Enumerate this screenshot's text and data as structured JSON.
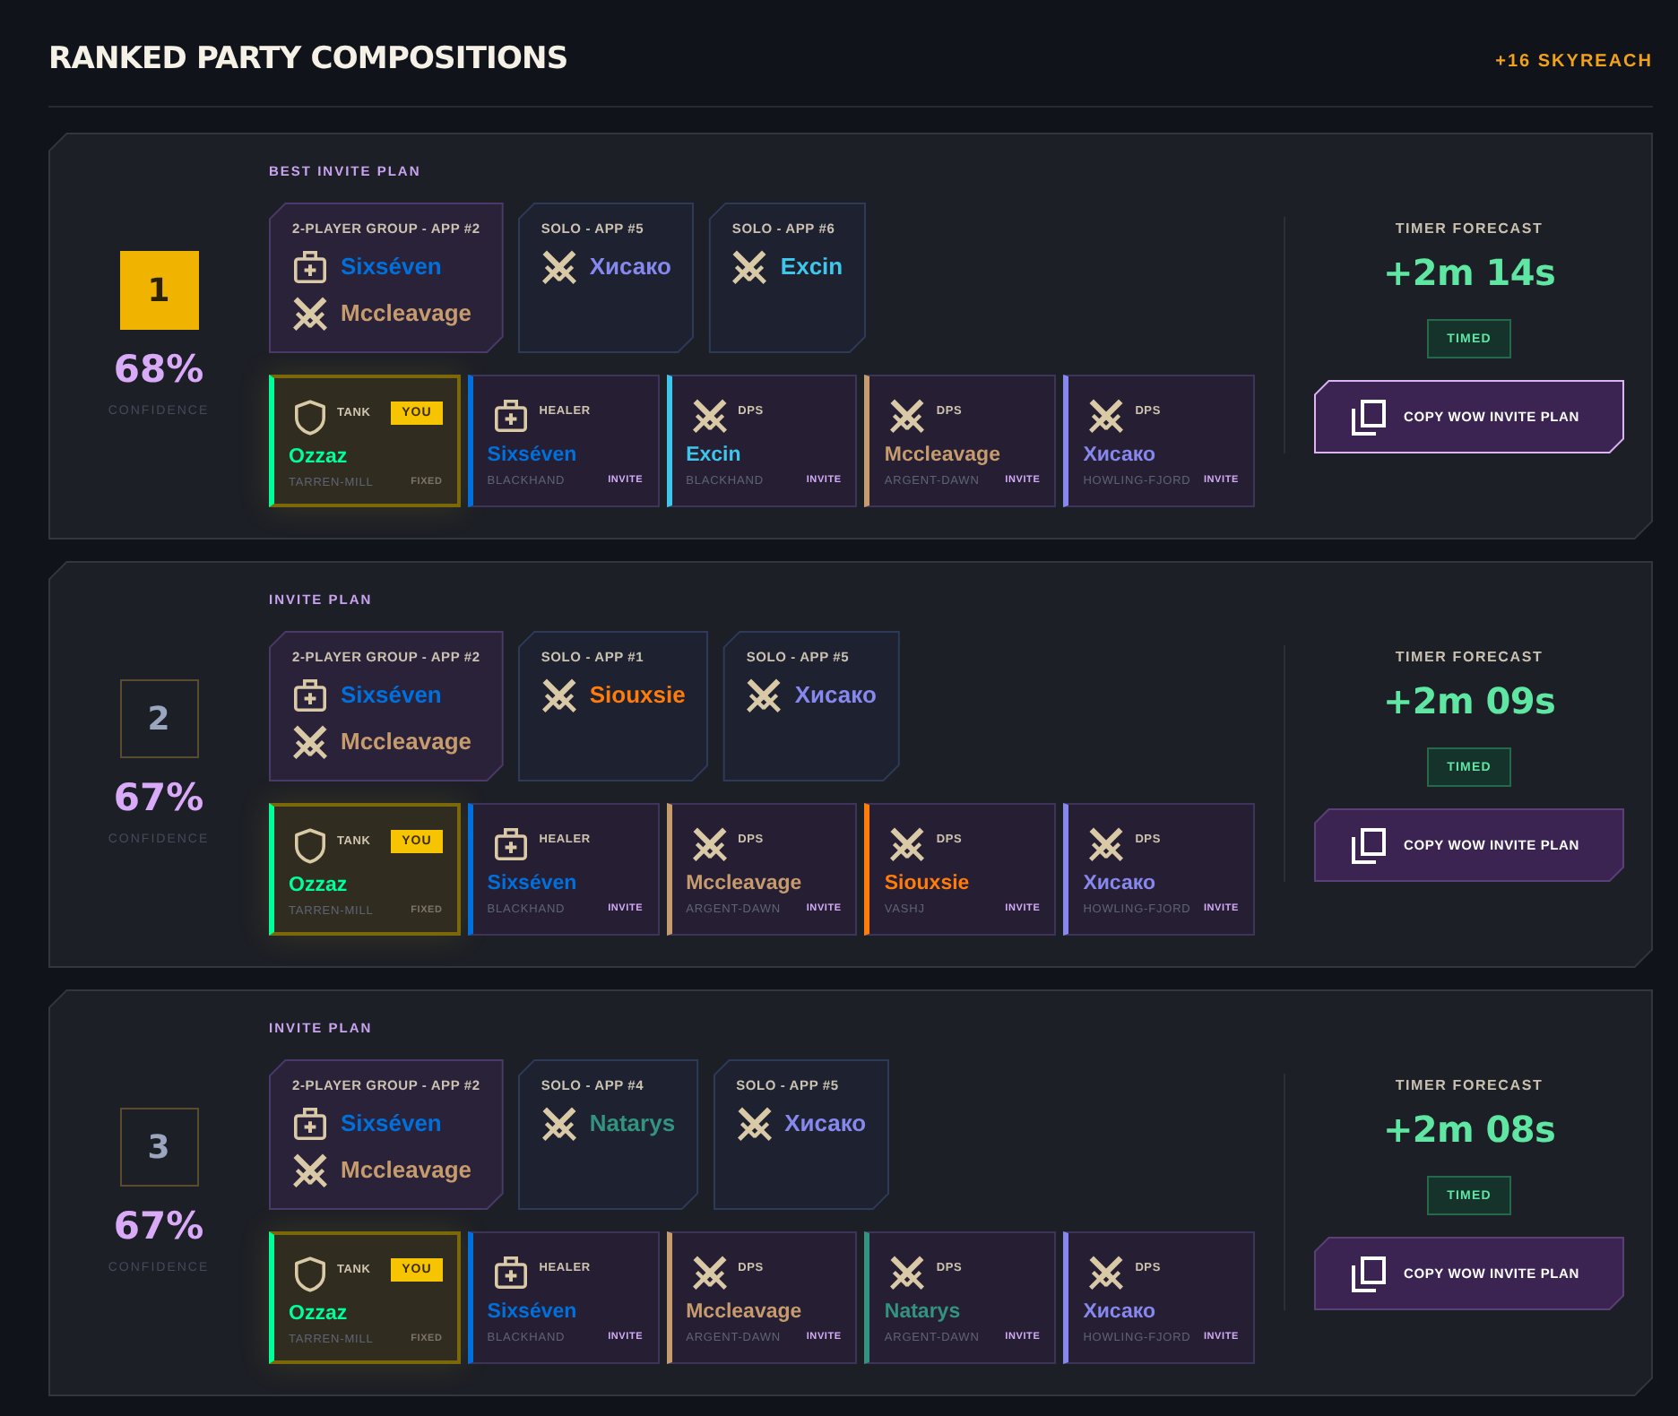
{
  "header": {
    "title": "RANKED PARTY COMPOSITIONS",
    "dungeon": "+16 SKYREACH"
  },
  "compositions": [
    {
      "rank": "1",
      "top_pick": true,
      "confidence": "68%",
      "confidence_label": "CONFIDENCE",
      "plan_label": "BEST INVITE PLAN",
      "applications": [
        {
          "kind": "group",
          "title": "2-PLAYER GROUP - APP #2",
          "members": [
            {
              "kind": "healer",
              "name": "Sixséven",
              "color": "#0070dd"
            },
            {
              "kind": "dps",
              "name": "Mccleavage",
              "color": "#c69b6d"
            }
          ]
        },
        {
          "kind": "solo",
          "title": "SOLO - APP #5",
          "members": [
            {
              "kind": "dps",
              "name": "Хисако",
              "color": "#8788ee"
            }
          ]
        },
        {
          "kind": "solo",
          "title": "SOLO - APP #6",
          "members": [
            {
              "kind": "dps",
              "name": "Excin",
              "color": "#3fc7eb"
            }
          ]
        }
      ],
      "slots": [
        {
          "kind": "tank",
          "role": "TANK",
          "is_you": true,
          "badge": "YOU",
          "name": "Ozzaz",
          "color": "#00ff98",
          "realm": "TARREN-MILL",
          "status": "FIXED"
        },
        {
          "kind": "healer",
          "role": "HEALER",
          "is_you": false,
          "name": "Sixséven",
          "color": "#0070dd",
          "realm": "BLACKHAND",
          "status": "INVITE"
        },
        {
          "kind": "dps",
          "role": "DPS",
          "is_you": false,
          "name": "Excin",
          "color": "#3fc7eb",
          "realm": "BLACKHAND",
          "status": "INVITE"
        },
        {
          "kind": "dps",
          "role": "DPS",
          "is_you": false,
          "name": "Mccleavage",
          "color": "#c69b6d",
          "realm": "ARGENT-DAWN",
          "status": "INVITE"
        },
        {
          "kind": "dps",
          "role": "DPS",
          "is_you": false,
          "name": "Хисако",
          "color": "#8788ee",
          "realm": "HOWLING-FJORD",
          "status": "INVITE"
        }
      ],
      "forecast": {
        "label": "TIMER FORECAST",
        "value": "+2m 14s",
        "verdict": "TIMED"
      },
      "button": "COPY WOW INVITE PLAN"
    },
    {
      "rank": "2",
      "top_pick": false,
      "confidence": "67%",
      "confidence_label": "CONFIDENCE",
      "plan_label": "INVITE PLAN",
      "applications": [
        {
          "kind": "group",
          "title": "2-PLAYER GROUP - APP #2",
          "members": [
            {
              "kind": "healer",
              "name": "Sixséven",
              "color": "#0070dd"
            },
            {
              "kind": "dps",
              "name": "Mccleavage",
              "color": "#c69b6d"
            }
          ]
        },
        {
          "kind": "solo",
          "title": "SOLO - APP #1",
          "members": [
            {
              "kind": "dps",
              "name": "Siouxsie",
              "color": "#ff7c0a"
            }
          ]
        },
        {
          "kind": "solo",
          "title": "SOLO - APP #5",
          "members": [
            {
              "kind": "dps",
              "name": "Хисако",
              "color": "#8788ee"
            }
          ]
        }
      ],
      "slots": [
        {
          "kind": "tank",
          "role": "TANK",
          "is_you": true,
          "badge": "YOU",
          "name": "Ozzaz",
          "color": "#00ff98",
          "realm": "TARREN-MILL",
          "status": "FIXED"
        },
        {
          "kind": "healer",
          "role": "HEALER",
          "is_you": false,
          "name": "Sixséven",
          "color": "#0070dd",
          "realm": "BLACKHAND",
          "status": "INVITE"
        },
        {
          "kind": "dps",
          "role": "DPS",
          "is_you": false,
          "name": "Mccleavage",
          "color": "#c69b6d",
          "realm": "ARGENT-DAWN",
          "status": "INVITE"
        },
        {
          "kind": "dps",
          "role": "DPS",
          "is_you": false,
          "name": "Siouxsie",
          "color": "#ff7c0a",
          "realm": "VASHJ",
          "status": "INVITE"
        },
        {
          "kind": "dps",
          "role": "DPS",
          "is_you": false,
          "name": "Хисако",
          "color": "#8788ee",
          "realm": "HOWLING-FJORD",
          "status": "INVITE"
        }
      ],
      "forecast": {
        "label": "TIMER FORECAST",
        "value": "+2m 09s",
        "verdict": "TIMED"
      },
      "button": "COPY WOW INVITE PLAN"
    },
    {
      "rank": "3",
      "top_pick": false,
      "confidence": "67%",
      "confidence_label": "CONFIDENCE",
      "plan_label": "INVITE PLAN",
      "applications": [
        {
          "kind": "group",
          "title": "2-PLAYER GROUP - APP #2",
          "members": [
            {
              "kind": "healer",
              "name": "Sixséven",
              "color": "#0070dd"
            },
            {
              "kind": "dps",
              "name": "Mccleavage",
              "color": "#c69b6d"
            }
          ]
        },
        {
          "kind": "solo",
          "title": "SOLO - APP #4",
          "members": [
            {
              "kind": "dps",
              "name": "Natarys",
              "color": "#33937f"
            }
          ]
        },
        {
          "kind": "solo",
          "title": "SOLO - APP #5",
          "members": [
            {
              "kind": "dps",
              "name": "Хисако",
              "color": "#8788ee"
            }
          ]
        }
      ],
      "slots": [
        {
          "kind": "tank",
          "role": "TANK",
          "is_you": true,
          "badge": "YOU",
          "name": "Ozzaz",
          "color": "#00ff98",
          "realm": "TARREN-MILL",
          "status": "FIXED"
        },
        {
          "kind": "healer",
          "role": "HEALER",
          "is_you": false,
          "name": "Sixséven",
          "color": "#0070dd",
          "realm": "BLACKHAND",
          "status": "INVITE"
        },
        {
          "kind": "dps",
          "role": "DPS",
          "is_you": false,
          "name": "Mccleavage",
          "color": "#c69b6d",
          "realm": "ARGENT-DAWN",
          "status": "INVITE"
        },
        {
          "kind": "dps",
          "role": "DPS",
          "is_you": false,
          "name": "Natarys",
          "color": "#33937f",
          "realm": "ARGENT-DAWN",
          "status": "INVITE"
        },
        {
          "kind": "dps",
          "role": "DPS",
          "is_you": false,
          "name": "Хисако",
          "color": "#8788ee",
          "realm": "HOWLING-FJORD",
          "status": "INVITE"
        }
      ],
      "forecast": {
        "label": "TIMER FORECAST",
        "value": "+2m 08s",
        "verdict": "TIMED"
      },
      "button": "COPY WOW INVITE PLAN"
    }
  ]
}
